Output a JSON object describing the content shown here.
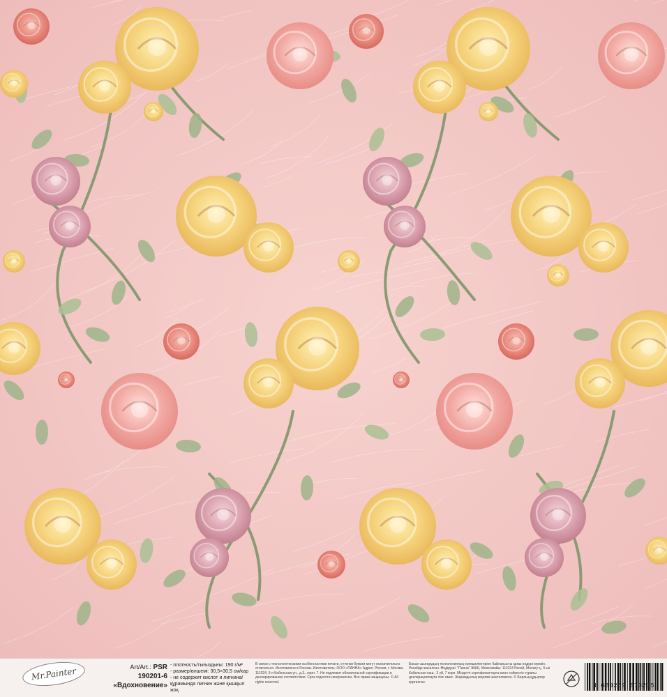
{
  "paper": {
    "palette": {
      "background": "#f3c9c6",
      "yellow_rose": "#f5d27a",
      "pink_rose": "#f2a9a3",
      "coral_rose": "#e98a7e",
      "mauve_rose": "#d9a0ad",
      "leaf": "#9fb48a",
      "stem": "#8a9b73"
    }
  },
  "footer": {
    "logo_text": "Mr.Painter",
    "art_label": "Art/Art.:",
    "art_code": "PSR",
    "art_number": "190201-6",
    "collection_name": "«Вдохновение»",
    "specs": [
      "- плотность/тығыздығы: 190 г/м²",
      "- размер/өлшемі: 30,5×30,5 см/кар",
      "- не содержит кислот и лигнина/",
      "құрамында лигнин және қышқыл жоқ"
    ],
    "legal_text": "В связи с технологическими особенностями печати, оттенки бумаги могут незначительно отличаться. Изготовлено в России. Изготовитель: ООО «ПАННА» Адрес: Россия, г. Москва, 111024, 5-я Кабельная ул., д.3., корп. 7. Не подлежит обязательной сертификации и декларированию соответствия. Срок годности неограничен. Все права защищены. © All rights reserved.",
    "legal_text_2": "Басып шығарудың технологиялық ерекшеліктеріне байланысты қағаз өңдері мүмкін. Ресейде жасалған. Өндіруші: \"Панна\" ЖШҚ. Мекенжайы: 111024 Ресей, Мәскеу қ., 5-ші Кабельная көш., 3 үй, 7 корп. Міндетті сертификаттауға және сәйкестік туралы декларациялауға тиіс емес. Жарамдылық мерзімі шектелмеген. © Барлық құқықтар қорғалған.",
    "barcode_digits": "4 680269 870215"
  }
}
